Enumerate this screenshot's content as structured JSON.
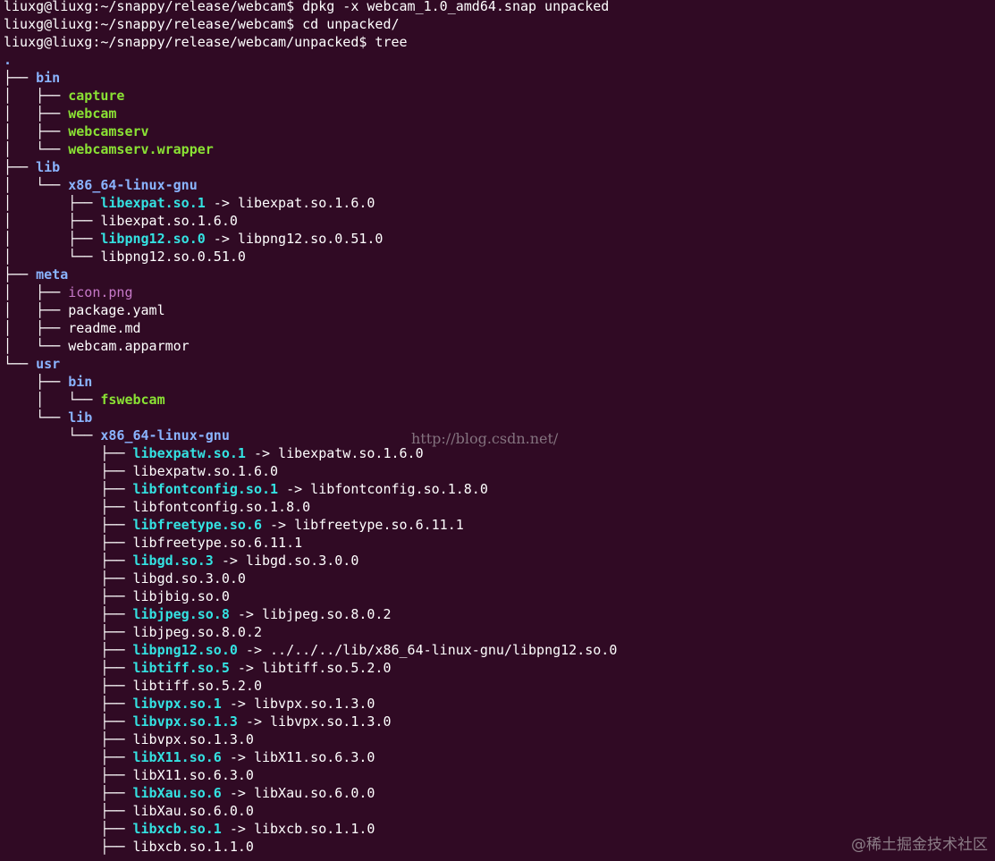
{
  "colors": {
    "background": "#300a24",
    "text": "#ffffff",
    "directory": "#8ab4ff",
    "executable": "#8ae234",
    "symlink": "#34e2e2",
    "image": "#c779c9"
  },
  "watermark": {
    "url": "http://blog.csdn.net/",
    "brand": "@稀土掘金技术社区"
  },
  "lines": [
    [
      {
        "t": "liuxg@liuxg:~/snappy/release/webcam$ dpkg -x webcam_1.0_amd64.snap unpacked",
        "c": "prompt"
      }
    ],
    [
      {
        "t": "liuxg@liuxg:~/snappy/release/webcam$ cd unpacked/",
        "c": "prompt"
      }
    ],
    [
      {
        "t": "liuxg@liuxg:~/snappy/release/webcam/unpacked$ tree",
        "c": "prompt"
      }
    ],
    [
      {
        "t": ".",
        "c": "dir"
      }
    ],
    [
      {
        "t": "├── ",
        "c": "tree"
      },
      {
        "t": "bin",
        "c": "dir"
      }
    ],
    [
      {
        "t": "│   ├── ",
        "c": "tree"
      },
      {
        "t": "capture",
        "c": "exec"
      }
    ],
    [
      {
        "t": "│   ├── ",
        "c": "tree"
      },
      {
        "t": "webcam",
        "c": "exec"
      }
    ],
    [
      {
        "t": "│   ├── ",
        "c": "tree"
      },
      {
        "t": "webcamserv",
        "c": "exec"
      }
    ],
    [
      {
        "t": "│   └── ",
        "c": "tree"
      },
      {
        "t": "webcamserv.wrapper",
        "c": "exec"
      }
    ],
    [
      {
        "t": "├── ",
        "c": "tree"
      },
      {
        "t": "lib",
        "c": "dir"
      }
    ],
    [
      {
        "t": "│   └── ",
        "c": "tree"
      },
      {
        "t": "x86_64-linux-gnu",
        "c": "dir"
      }
    ],
    [
      {
        "t": "│       ├── ",
        "c": "tree"
      },
      {
        "t": "libexpat.so.1",
        "c": "link"
      },
      {
        "t": " -> libexpat.so.1.6.0",
        "c": "plain"
      }
    ],
    [
      {
        "t": "│       ├── ",
        "c": "tree"
      },
      {
        "t": "libexpat.so.1.6.0",
        "c": "plain"
      }
    ],
    [
      {
        "t": "│       ├── ",
        "c": "tree"
      },
      {
        "t": "libpng12.so.0",
        "c": "link"
      },
      {
        "t": " -> libpng12.so.0.51.0",
        "c": "plain"
      }
    ],
    [
      {
        "t": "│       └── ",
        "c": "tree"
      },
      {
        "t": "libpng12.so.0.51.0",
        "c": "plain"
      }
    ],
    [
      {
        "t": "├── ",
        "c": "tree"
      },
      {
        "t": "meta",
        "c": "dir"
      }
    ],
    [
      {
        "t": "│   ├── ",
        "c": "tree"
      },
      {
        "t": "icon.png",
        "c": "image"
      }
    ],
    [
      {
        "t": "│   ├── ",
        "c": "tree"
      },
      {
        "t": "package.yaml",
        "c": "plain"
      }
    ],
    [
      {
        "t": "│   ├── ",
        "c": "tree"
      },
      {
        "t": "readme.md",
        "c": "plain"
      }
    ],
    [
      {
        "t": "│   └── ",
        "c": "tree"
      },
      {
        "t": "webcam.apparmor",
        "c": "plain"
      }
    ],
    [
      {
        "t": "└── ",
        "c": "tree"
      },
      {
        "t": "usr",
        "c": "dir"
      }
    ],
    [
      {
        "t": "    ├── ",
        "c": "tree"
      },
      {
        "t": "bin",
        "c": "dir"
      }
    ],
    [
      {
        "t": "    │   └── ",
        "c": "tree"
      },
      {
        "t": "fswebcam",
        "c": "exec"
      }
    ],
    [
      {
        "t": "    └── ",
        "c": "tree"
      },
      {
        "t": "lib",
        "c": "dir"
      }
    ],
    [
      {
        "t": "        └── ",
        "c": "tree"
      },
      {
        "t": "x86_64-linux-gnu",
        "c": "dir"
      }
    ],
    [
      {
        "t": "            ├── ",
        "c": "tree"
      },
      {
        "t": "libexpatw.so.1",
        "c": "link"
      },
      {
        "t": " -> libexpatw.so.1.6.0",
        "c": "plain"
      }
    ],
    [
      {
        "t": "            ├── ",
        "c": "tree"
      },
      {
        "t": "libexpatw.so.1.6.0",
        "c": "plain"
      }
    ],
    [
      {
        "t": "            ├── ",
        "c": "tree"
      },
      {
        "t": "libfontconfig.so.1",
        "c": "link"
      },
      {
        "t": " -> libfontconfig.so.1.8.0",
        "c": "plain"
      }
    ],
    [
      {
        "t": "            ├── ",
        "c": "tree"
      },
      {
        "t": "libfontconfig.so.1.8.0",
        "c": "plain"
      }
    ],
    [
      {
        "t": "            ├── ",
        "c": "tree"
      },
      {
        "t": "libfreetype.so.6",
        "c": "link"
      },
      {
        "t": " -> libfreetype.so.6.11.1",
        "c": "plain"
      }
    ],
    [
      {
        "t": "            ├── ",
        "c": "tree"
      },
      {
        "t": "libfreetype.so.6.11.1",
        "c": "plain"
      }
    ],
    [
      {
        "t": "            ├── ",
        "c": "tree"
      },
      {
        "t": "libgd.so.3",
        "c": "link"
      },
      {
        "t": " -> libgd.so.3.0.0",
        "c": "plain"
      }
    ],
    [
      {
        "t": "            ├── ",
        "c": "tree"
      },
      {
        "t": "libgd.so.3.0.0",
        "c": "plain"
      }
    ],
    [
      {
        "t": "            ├── ",
        "c": "tree"
      },
      {
        "t": "libjbig.so.0",
        "c": "plain"
      }
    ],
    [
      {
        "t": "            ├── ",
        "c": "tree"
      },
      {
        "t": "libjpeg.so.8",
        "c": "link"
      },
      {
        "t": " -> libjpeg.so.8.0.2",
        "c": "plain"
      }
    ],
    [
      {
        "t": "            ├── ",
        "c": "tree"
      },
      {
        "t": "libjpeg.so.8.0.2",
        "c": "plain"
      }
    ],
    [
      {
        "t": "            ├── ",
        "c": "tree"
      },
      {
        "t": "libpng12.so.0",
        "c": "link"
      },
      {
        "t": " -> ../../../lib/x86_64-linux-gnu/libpng12.so.0",
        "c": "plain"
      }
    ],
    [
      {
        "t": "            ├── ",
        "c": "tree"
      },
      {
        "t": "libtiff.so.5",
        "c": "link"
      },
      {
        "t": " -> libtiff.so.5.2.0",
        "c": "plain"
      }
    ],
    [
      {
        "t": "            ├── ",
        "c": "tree"
      },
      {
        "t": "libtiff.so.5.2.0",
        "c": "plain"
      }
    ],
    [
      {
        "t": "            ├── ",
        "c": "tree"
      },
      {
        "t": "libvpx.so.1",
        "c": "link"
      },
      {
        "t": " -> libvpx.so.1.3.0",
        "c": "plain"
      }
    ],
    [
      {
        "t": "            ├── ",
        "c": "tree"
      },
      {
        "t": "libvpx.so.1.3",
        "c": "link"
      },
      {
        "t": " -> libvpx.so.1.3.0",
        "c": "plain"
      }
    ],
    [
      {
        "t": "            ├── ",
        "c": "tree"
      },
      {
        "t": "libvpx.so.1.3.0",
        "c": "plain"
      }
    ],
    [
      {
        "t": "            ├── ",
        "c": "tree"
      },
      {
        "t": "libX11.so.6",
        "c": "link"
      },
      {
        "t": " -> libX11.so.6.3.0",
        "c": "plain"
      }
    ],
    [
      {
        "t": "            ├── ",
        "c": "tree"
      },
      {
        "t": "libX11.so.6.3.0",
        "c": "plain"
      }
    ],
    [
      {
        "t": "            ├── ",
        "c": "tree"
      },
      {
        "t": "libXau.so.6",
        "c": "link"
      },
      {
        "t": " -> libXau.so.6.0.0",
        "c": "plain"
      }
    ],
    [
      {
        "t": "            ├── ",
        "c": "tree"
      },
      {
        "t": "libXau.so.6.0.0",
        "c": "plain"
      }
    ],
    [
      {
        "t": "            ├── ",
        "c": "tree"
      },
      {
        "t": "libxcb.so.1",
        "c": "link"
      },
      {
        "t": " -> libxcb.so.1.1.0",
        "c": "plain"
      }
    ],
    [
      {
        "t": "            ├── ",
        "c": "tree"
      },
      {
        "t": "libxcb.so.1.1.0",
        "c": "plain"
      }
    ]
  ]
}
